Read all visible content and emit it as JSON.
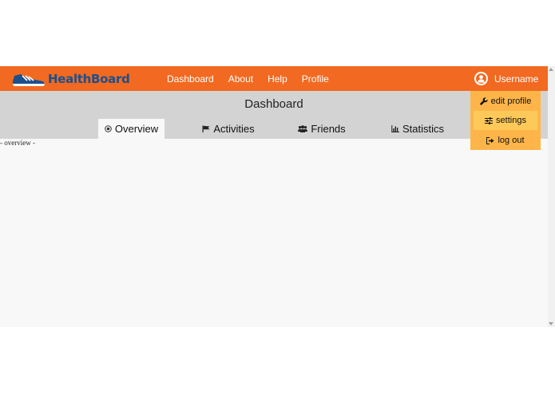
{
  "brand": {
    "name": "HealthBoard",
    "primary_color": "#f26a22",
    "logo_text_color": "#1d4f8a",
    "shoe_icon": "sneaker-icon"
  },
  "nav": {
    "links": [
      {
        "label": "Dashboard"
      },
      {
        "label": "About"
      },
      {
        "label": "Help"
      },
      {
        "label": "Profile"
      }
    ],
    "user": {
      "name": "Username",
      "icon": "user-icon"
    }
  },
  "header": {
    "title": "Dashboard",
    "background": "#d3d3d3"
  },
  "tabs": [
    {
      "label": "Overview",
      "icon": "target-icon",
      "active": true
    },
    {
      "label": "Activities",
      "icon": "flag-icon",
      "active": false
    },
    {
      "label": "Friends",
      "icon": "users-icon",
      "active": false
    },
    {
      "label": "Statistics",
      "icon": "bar-chart-icon",
      "active": false
    }
  ],
  "content": {
    "text": "- overview -"
  },
  "user_menu": {
    "background": "#fdb54a",
    "items": [
      {
        "label": "edit profile",
        "icon": "wrench-icon"
      },
      {
        "label": "settings",
        "icon": "sliders-icon"
      },
      {
        "label": "log out",
        "icon": "sign-out-icon"
      }
    ]
  }
}
